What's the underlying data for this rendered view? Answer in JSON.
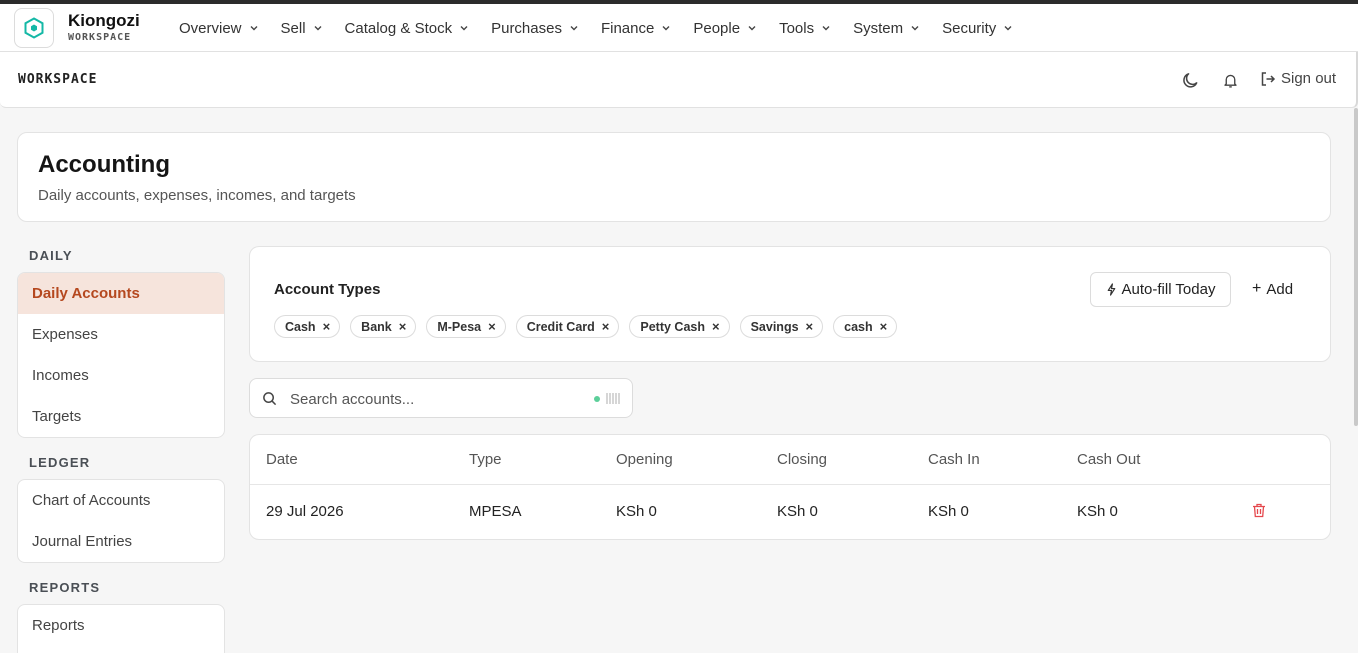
{
  "brand": {
    "name": "Kiongozi",
    "sub": "WORKSPACE",
    "accent": "#14b8a6"
  },
  "nav": [
    {
      "label": "Overview"
    },
    {
      "label": "Sell"
    },
    {
      "label": "Catalog & Stock"
    },
    {
      "label": "Purchases"
    },
    {
      "label": "Finance"
    },
    {
      "label": "People"
    },
    {
      "label": "Tools"
    },
    {
      "label": "System"
    },
    {
      "label": "Security"
    }
  ],
  "subbar": {
    "label": "WORKSPACE",
    "sign_out": "Sign out"
  },
  "page": {
    "title": "Accounting",
    "subtitle": "Daily accounts, expenses, incomes, and targets"
  },
  "sidebar": {
    "sections": [
      {
        "heading": "DAILY",
        "items": [
          {
            "label": "Daily Accounts"
          },
          {
            "label": "Expenses"
          },
          {
            "label": "Incomes"
          },
          {
            "label": "Targets"
          }
        ]
      },
      {
        "heading": "LEDGER",
        "items": [
          {
            "label": "Chart of Accounts"
          },
          {
            "label": "Journal Entries"
          }
        ]
      },
      {
        "heading": "REPORTS",
        "items": [
          {
            "label": "Reports"
          }
        ]
      }
    ],
    "active_color": "#b5481f"
  },
  "account_types": {
    "title": "Account Types",
    "autofill_label": "Auto-fill Today",
    "add_label": "Add",
    "chips": [
      "Cash",
      "Bank",
      "M-Pesa",
      "Credit Card",
      "Petty Cash",
      "Savings",
      "cash"
    ]
  },
  "search": {
    "placeholder": "Search accounts..."
  },
  "table": {
    "headers": [
      "Date",
      "Type",
      "Opening",
      "Closing",
      "Cash In",
      "Cash Out"
    ],
    "rows": [
      {
        "date": "29 Jul 2026",
        "type": "MPESA",
        "opening": "KSh 0",
        "closing": "KSh 0",
        "cash_in": "KSh 0",
        "cash_out": "KSh 0"
      }
    ],
    "delete_color": "#e5484d"
  }
}
